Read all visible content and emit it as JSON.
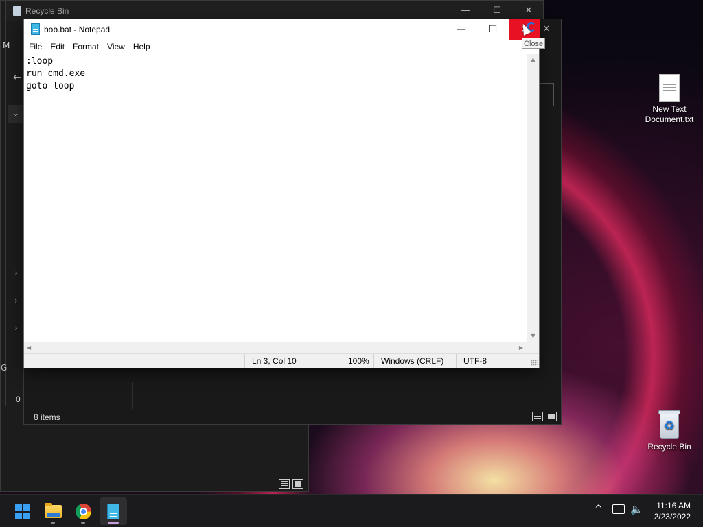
{
  "desktop": {
    "icons": [
      {
        "label": "New Text Document.txt",
        "icon": "text-document-icon"
      },
      {
        "label": "Recycle Bin",
        "icon": "recycle-bin-icon"
      }
    ]
  },
  "explorer_window": {
    "title": "Recycle Bin",
    "minimize": "—",
    "maximize": "☐",
    "close": "✕",
    "status_items": "8 items",
    "status_items_back": "0 i",
    "side_letter_m": "M",
    "side_letter_g": "G"
  },
  "notepad": {
    "title": "bob.bat - Notepad",
    "minimize": "—",
    "maximize": "☐",
    "close": "✕",
    "menu": [
      "File",
      "Edit",
      "Format",
      "View",
      "Help"
    ],
    "content": ":loop\nrun cmd.exe\ngoto loop",
    "status": {
      "position": "Ln 3, Col 10",
      "zoom": "100%",
      "line_ending": "Windows (CRLF)",
      "encoding": "UTF-8"
    },
    "scroll_up": "▲",
    "scroll_down": "▼",
    "scroll_left": "◀",
    "scroll_right": "▶"
  },
  "tooltip": "Close",
  "taskbar": {
    "apps": [
      {
        "name": "Start",
        "icon": "windows-start-icon"
      },
      {
        "name": "File Explorer",
        "icon": "folder-icon"
      },
      {
        "name": "Google Chrome",
        "icon": "chrome-icon"
      },
      {
        "name": "Notepad",
        "icon": "notepad-icon"
      }
    ],
    "tray_chevron": "^",
    "clock_time": "11:16 AM",
    "clock_date": "2/23/2022"
  },
  "colors": {
    "close_hover": "#e81123",
    "taskbar_bg": "#1b1b1d",
    "explorer_bg": "#1c1c1c",
    "accent_blue": "#3aa0f3"
  }
}
